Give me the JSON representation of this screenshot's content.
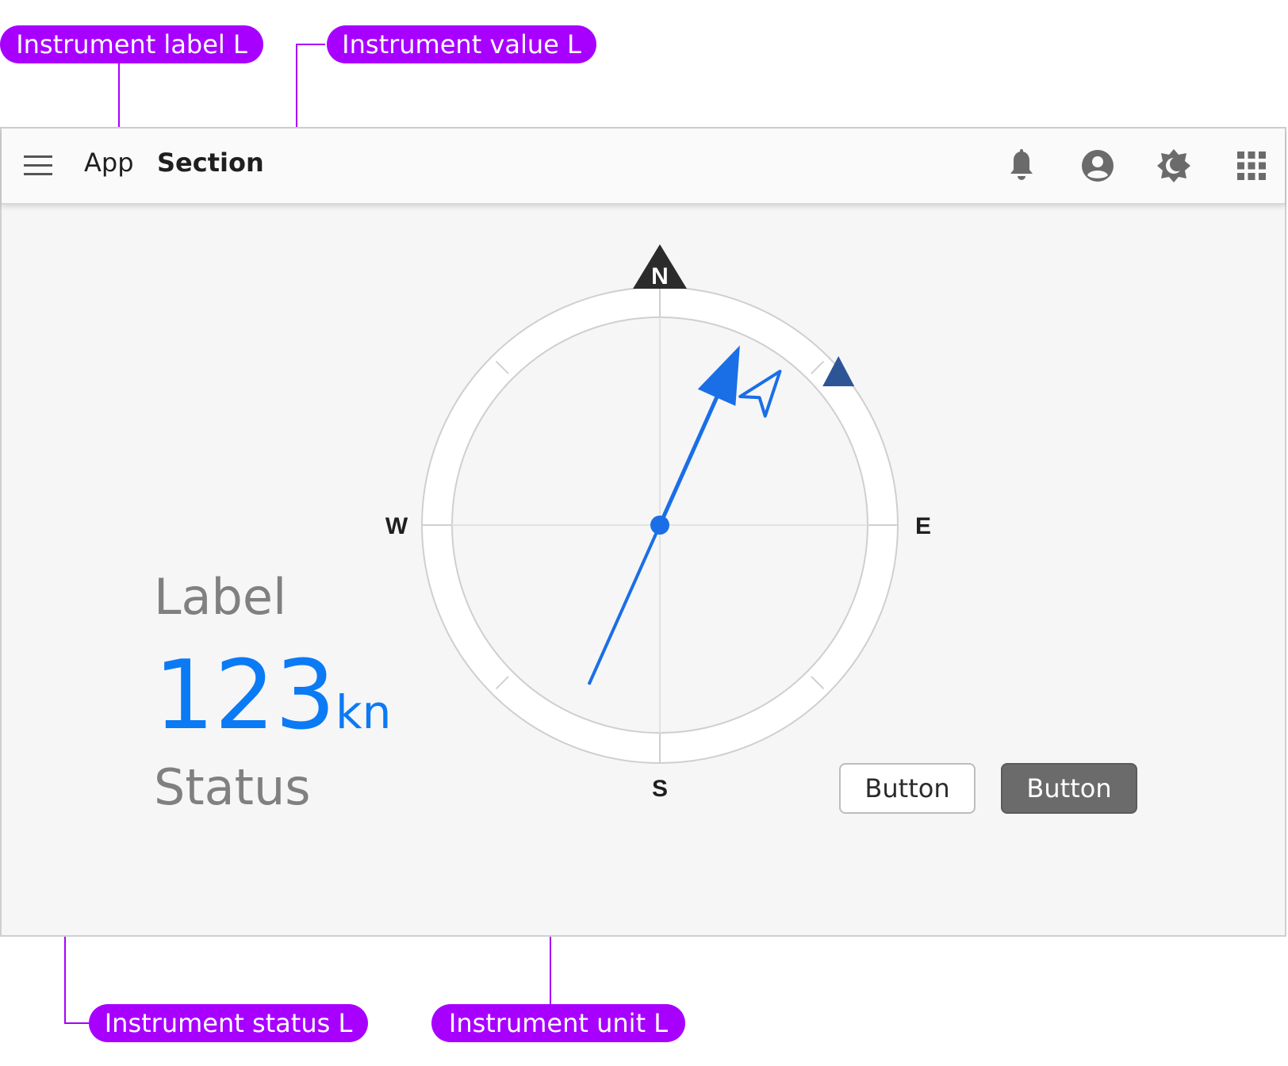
{
  "annotations": {
    "label_callout": "Instrument label L",
    "value_callout": "Instrument value L",
    "status_callout": "Instrument status L",
    "unit_callout": "Instrument unit L"
  },
  "top_bar": {
    "app_name": "App",
    "section_name": "Section",
    "icons": [
      "menu-icon",
      "notification-bell-icon",
      "user-account-icon",
      "brightness-icon",
      "apps-grid-icon"
    ]
  },
  "instrument": {
    "label": "Label",
    "value": "123",
    "unit": "kn",
    "status": "Status"
  },
  "compass": {
    "north": "N",
    "east": "E",
    "south": "S",
    "west": "W",
    "needle_heading_deg": 24,
    "course_marker_deg": 38,
    "set_marker_deg": 50
  },
  "buttons": {
    "secondary_label": "Button",
    "primary_label": "Button"
  },
  "colors": {
    "annotation": "#a800ff",
    "accent": "#0b7af5",
    "needle": "#1a6fe6",
    "set_marker": "#2d5596",
    "primary_button": "#6b6b6b"
  }
}
